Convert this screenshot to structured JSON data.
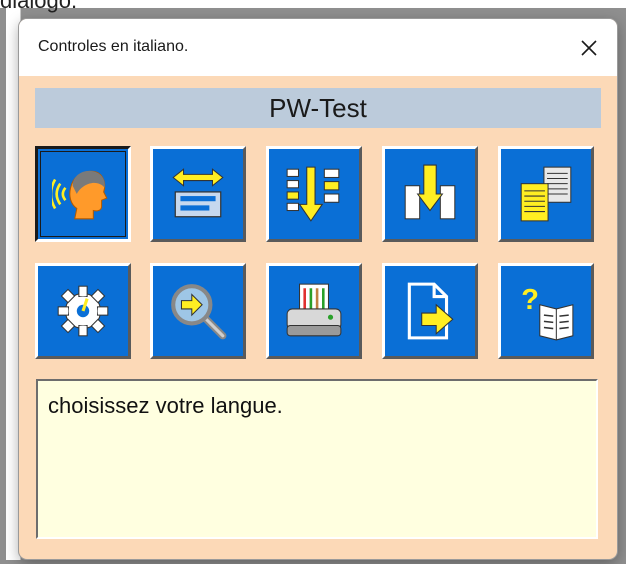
{
  "background": {
    "fragment_text": "dialogo."
  },
  "dialog": {
    "title": "Controles en italiano.",
    "close_glyph": "✕",
    "header": "PW-Test",
    "message": "choisissez votre langue.",
    "icons": [
      {
        "name": "speech-head-icon",
        "selected": true
      },
      {
        "name": "horizontal-arrows-icon",
        "selected": false
      },
      {
        "name": "vertical-sort-icon",
        "selected": false
      },
      {
        "name": "insert-down-icon",
        "selected": false
      },
      {
        "name": "documents-icon",
        "selected": false
      },
      {
        "name": "gear-icon",
        "selected": false
      },
      {
        "name": "magnifier-icon",
        "selected": false
      },
      {
        "name": "printer-icon",
        "selected": false
      },
      {
        "name": "export-file-icon",
        "selected": false
      },
      {
        "name": "help-book-icon",
        "selected": false
      }
    ]
  },
  "colors": {
    "dialog_bg": "#fcd9b7",
    "header_bg": "#bccbdb",
    "button_blue": "#0a6fd6",
    "icon_yellow": "#ffee22",
    "message_bg": "#ffffe0"
  }
}
